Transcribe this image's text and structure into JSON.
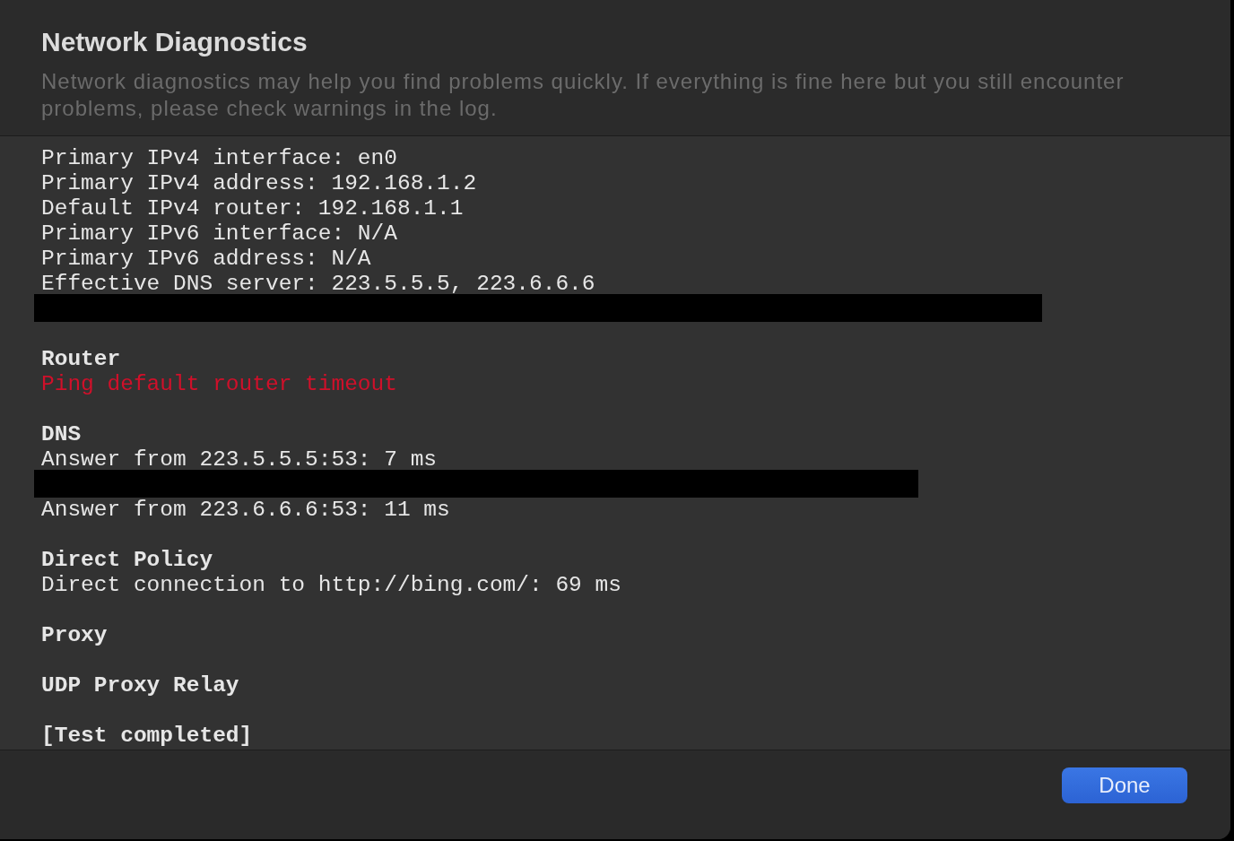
{
  "window": {
    "title": "Network Diagnostics",
    "description": "Network diagnostics may help you find problems quickly. If everything is fine here but you still encounter problems, please check warnings in the log."
  },
  "log": {
    "sections": [
      {
        "lines": [
          {
            "kind": "text",
            "text": "Primary IPv4 interface: en0"
          },
          {
            "kind": "text",
            "text": "Primary IPv4 address: 192.168.1.2"
          },
          {
            "kind": "text",
            "text": "Default IPv4 router: 192.168.1.1"
          },
          {
            "kind": "text",
            "text": "Primary IPv6 interface: N/A"
          },
          {
            "kind": "text",
            "text": "Primary IPv6 address: N/A"
          },
          {
            "kind": "text",
            "text": "Effective DNS server: 223.5.5.5, 223.6.6.6"
          },
          {
            "kind": "redacted"
          }
        ]
      },
      {
        "heading": "Router",
        "lines": [
          {
            "kind": "error",
            "text": "Ping default router timeout"
          }
        ]
      },
      {
        "heading": "DNS",
        "lines": [
          {
            "kind": "text",
            "text": "Answer from 223.5.5.5:53: 7 ms"
          },
          {
            "kind": "redacted"
          },
          {
            "kind": "text",
            "text": "Answer from 223.6.6.6:53: 11 ms"
          }
        ]
      },
      {
        "heading": "Direct Policy",
        "lines": [
          {
            "kind": "text",
            "text": "Direct connection to http://bing.com/: 69 ms"
          }
        ]
      },
      {
        "heading": "Proxy"
      },
      {
        "heading": "UDP Proxy Relay"
      },
      {
        "heading": "[Test completed]"
      }
    ]
  },
  "buttons": [
    {
      "label": "Done"
    }
  ]
}
